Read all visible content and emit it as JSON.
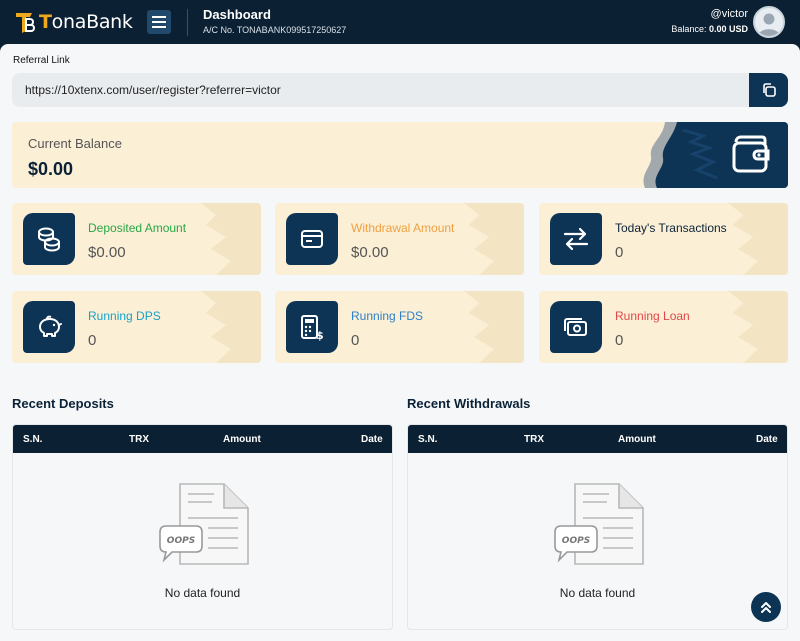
{
  "brand": {
    "name_prefix": "T",
    "name_rest": "onaBank",
    "accent": "#f0a91f"
  },
  "header": {
    "title": "Dashboard",
    "account": "A/C No. TONABANK099517250627",
    "username": "@victor",
    "balance_label": "Balance:",
    "balance_value": "0.00 USD"
  },
  "referral": {
    "label": "Referral Link",
    "url": "https://10xtenx.com/user/register?referrer=victor"
  },
  "balance": {
    "label": "Current Balance",
    "value": "$0.00"
  },
  "stats": [
    {
      "label": "Deposited Amount",
      "value": "$0.00",
      "color": "#28a745",
      "icon": "coins-icon"
    },
    {
      "label": "Withdrawal Amount",
      "value": "$0.00",
      "color": "#f0a040",
      "icon": "card-icon"
    },
    {
      "label": "Today's Transactions",
      "value": "0",
      "color": "#0b2236",
      "icon": "transfer-icon"
    },
    {
      "label": "Running DPS",
      "value": "0",
      "color": "#17a2c8",
      "icon": "piggy-bank-icon"
    },
    {
      "label": "Running FDS",
      "value": "0",
      "color": "#2f80c8",
      "icon": "calculator-money-icon"
    },
    {
      "label": "Running Loan",
      "value": "0",
      "color": "#e04848",
      "icon": "cash-icon"
    }
  ],
  "deposits": {
    "title": "Recent Deposits",
    "columns": [
      "S.N.",
      "TRX",
      "Amount",
      "Date"
    ],
    "rows": [],
    "empty_badge": "OOPS",
    "empty_text": "No data found"
  },
  "withdrawals": {
    "title": "Recent Withdrawals",
    "columns": [
      "S.N.",
      "TRX",
      "Amount",
      "Date"
    ],
    "rows": [],
    "empty_badge": "OOPS",
    "empty_text": "No data found"
  }
}
